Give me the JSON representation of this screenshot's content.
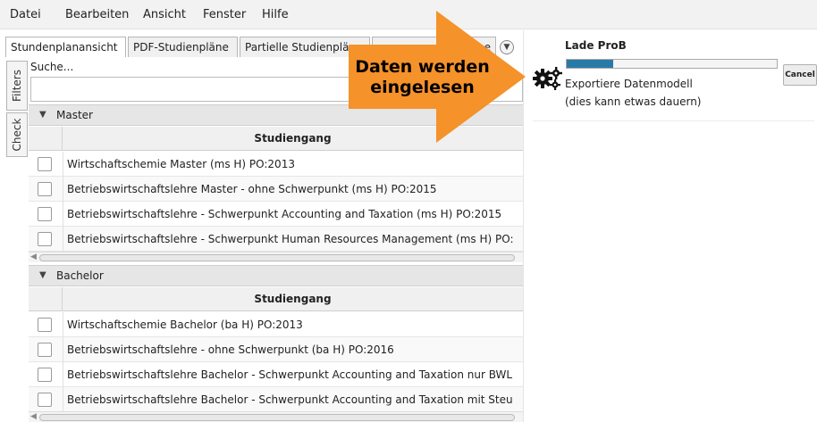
{
  "menubar": {
    "items": [
      "Datei",
      "Bearbeiten",
      "Ansicht",
      "Fenster",
      "Hilfe"
    ]
  },
  "tabs": [
    {
      "label": "Stundenplanansicht",
      "active": true
    },
    {
      "label": "PDF-Studienpläne",
      "active": false
    },
    {
      "label": "Partielle Studienpläne",
      "active": false
    },
    {
      "label": "...ine",
      "active": false
    }
  ],
  "side_tabs": [
    "Filters",
    "Check"
  ],
  "search": {
    "label": "Suche...",
    "value": ""
  },
  "groups": [
    {
      "title": "Master",
      "column_header": "Studiengang",
      "rows": [
        "Wirtschaftschemie Master (ms H) PO:2013",
        "Betriebswirtschaftslehre Master - ohne Schwerpunkt (ms H) PO:2015",
        "Betriebswirtschaftslehre - Schwerpunkt Accounting and Taxation (ms H) PO:2015",
        "Betriebswirtschaftslehre - Schwerpunkt Human Resources Management (ms H) PO:"
      ]
    },
    {
      "title": "Bachelor",
      "column_header": "Studiengang",
      "rows": [
        "Wirtschaftschemie Bachelor (ba H) PO:2013",
        "Betriebswirtschaftslehre - ohne Schwerpunkt (ba H) PO:2016",
        "Betriebswirtschaftslehre Bachelor - Schwerpunkt Accounting and Taxation nur BWL",
        "Betriebswirtschaftslehre Bachelor - Schwerpunkt Accounting and Taxation mit Steu"
      ]
    }
  ],
  "progress": {
    "title": "Lade ProB",
    "status": "Exportiere Datenmodell",
    "hint": "(dies kann etwas dauern)",
    "cancel_label": "Cancel",
    "fraction": 0.22,
    "icon": "gears-icon",
    "fill_color": "#2a7aa8"
  },
  "callout": {
    "line1": "Daten werden",
    "line2": "eingelesen",
    "color": "#f5922a"
  }
}
